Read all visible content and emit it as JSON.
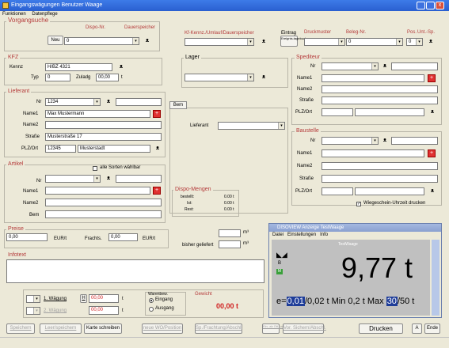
{
  "window": {
    "title": "Eingangswägungen  Benutzer  Waage",
    "close": "x"
  },
  "menu": [
    "Funktionen",
    "Datenpflege"
  ],
  "vorgang": {
    "title": "Vorgangsuche",
    "dispo_label": "Dispo-Nr.",
    "dauerspeicher": "Dauerspeicher",
    "neu": "Neu",
    "value": "0"
  },
  "kennung": {
    "label": "Kf-Kennz./Umlauf/Dauerspeicher",
    "eintrag": "Eintrag",
    "ereignis": "Ereignis-tagebuch"
  },
  "drucker": {
    "drucker_label": "Druckmuster",
    "beleg_label": "Beleg-Nr.",
    "beleg_value": "0",
    "pos_label": "Pos.",
    "unt_label": "Unt.-Sp.",
    "pos_value": "0"
  },
  "kfz": {
    "title": "KFZ",
    "kennz_label": "Kennz",
    "kennz_value": "H/BZ 4321",
    "typ_label": "Typ",
    "typ_value": "0",
    "zuladg_label": "Zuladg",
    "zuladg_value": "00,00",
    "unit": "t"
  },
  "lager": {
    "title": "Lager"
  },
  "spediteur": {
    "title": "Spediteur",
    "nr": "Nr",
    "name1": "Name1",
    "name2": "Name2",
    "strasse": "Straße",
    "plzort": "PLZ/Ort"
  },
  "lieferant": {
    "title": "Lieferant",
    "nr": "Nr",
    "nr_value": "1234",
    "name1": "Name1",
    "name1_value": "Max Mustermann",
    "name2": "Name2",
    "strasse": "Straße",
    "strasse_value": "Musterstraße 17",
    "plzort": "PLZ/Ort",
    "plz_value": "12345",
    "ort_value": "Musterstadt"
  },
  "tabs": {
    "bem": "Bem",
    "lieferant": "Lieferant"
  },
  "baustelle": {
    "title": "Baustelle",
    "nr": "Nr",
    "name1": "Name1",
    "name2": "Name2",
    "strasse": "Straße",
    "plzort": "PLZ/Ort"
  },
  "artikel": {
    "title": "Artikel",
    "alle_sorten": "alle Sorten wählbar",
    "nr": "Nr",
    "name1": "Name1",
    "name2": "Name2",
    "bem": "Bem"
  },
  "dispo": {
    "title": "Dispo-Mengen",
    "bestellt": "bestellt:",
    "bestellt_val": "0.00 t",
    "ist": "Ist:",
    "ist_val": "0.00 t",
    "rest": "Rest:",
    "rest_val": "0.00 t"
  },
  "wiegeschein": {
    "label": "Wiegeschein-Uhrzeit drucken"
  },
  "preise": {
    "title": "Preise",
    "preis_value": "0,00",
    "eur_t": "EUR/t",
    "frachts_label": "Frachts.",
    "frachts_value": "0,00",
    "eur_t2": "EUR/t",
    "m3": "m³",
    "bisher": "bisher geliefert",
    "m3b": "m³"
  },
  "infotext": {
    "title": "Infotext"
  },
  "waegung": {
    "w1_label": "1. Wägung",
    "w1_value": "00,00",
    "w2_label": "2. Wägung",
    "w2_value": "00,00",
    "unit": "t",
    "h": "H",
    "waren_title": "Warenbew.",
    "eingang": "Eingang",
    "ausgang": "Ausgang",
    "gewicht_title": "Gewicht",
    "gewicht_value": "00,00 t"
  },
  "buttons": {
    "speichern": "Speichern",
    "leer": "Leer/speichern",
    "karte": "Karte schreiben",
    "neue_wo": "neue WO/Position",
    "sp_fracht": "Sp./Frachtung/Abschl.",
    "ein": "Ein- ab Ott nach",
    "vor": "Vor. Sichern/Abschl.",
    "drucken": "Drucken",
    "a": "A",
    "ende": "Ende"
  },
  "scale": {
    "title": "DISOVIEW Anzeige TestWaage",
    "menu": [
      "Datei",
      "Einstellungen",
      "Info"
    ],
    "scale_name": "TestWaage",
    "value": "9,77 t",
    "e": "e=",
    "e_val": "0,01",
    "e_rest": "/0,02 t  Min 0,2 t  Max ",
    "max_val": "30",
    "max_rest": "/50 t",
    "ind": "B",
    "ind2": "M"
  }
}
